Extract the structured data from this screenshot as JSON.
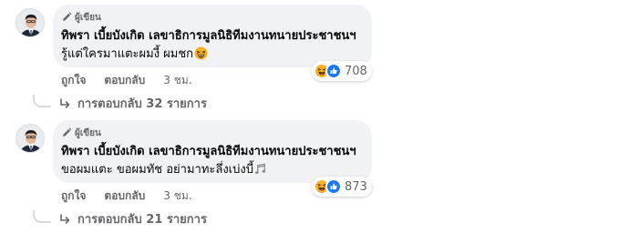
{
  "comments": [
    {
      "badge": "ผู้เขียน",
      "author": "ทิพรา เบี้ยบังเกิด เลขาธิการมูลนิธิทีมงานทนายประชาชนฯ",
      "text": "รู้แต่ใครมาแตะผมงี้ ผมชก",
      "emoji_trailing": "laughing-face",
      "reaction_count": "708",
      "like_label": "ถูกใจ",
      "reply_label": "ตอบกลับ",
      "time": "3 ชม.",
      "replies_label": "การตอบกลับ 32 รายการ"
    },
    {
      "badge": "ผู้เขียน",
      "author": "ทิพรา เบี้ยบังเกิด เลขาธิการมูลนิธิทีมงานทนายประชาชนฯ",
      "text": "ขอผมแตะ ขอผมทัช อย่ามาทะลึ่งเบ่งบี้",
      "emoji_trailing": "music-note",
      "reaction_count": "873",
      "like_label": "ถูกใจ",
      "reply_label": "ตอบกลับ",
      "time": "3 ชม.",
      "replies_label": "การตอบกลับ 21 รายการ"
    }
  ],
  "colors": {
    "bubble": "#f0f2f5",
    "secondary_text": "#65676b",
    "like_blue": "#1877f2",
    "haha_yellow": "#f7b125"
  }
}
